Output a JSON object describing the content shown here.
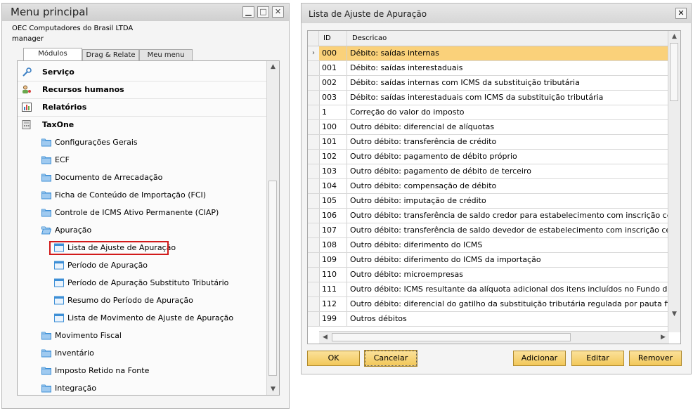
{
  "menu_window": {
    "title": "Menu principal",
    "company": "OEC Computadores do Brasil LTDA",
    "user": "manager",
    "tabs": [
      {
        "label": "Módulos",
        "active": true
      },
      {
        "label": "Drag & Relate",
        "active": false
      },
      {
        "label": "Meu menu",
        "active": false
      }
    ],
    "modules": [
      {
        "label": "Serviço",
        "icon": "wrench-icon"
      },
      {
        "label": "Recursos humanos",
        "icon": "people-icon"
      },
      {
        "label": "Relatórios",
        "icon": "report-chart-icon"
      },
      {
        "label": "TaxOne",
        "icon": "calculator-icon"
      }
    ],
    "taxone_folders_top": [
      "Configurações Gerais",
      "ECF",
      "Documento de Arrecadação",
      "Ficha de Conteúdo de Importação (FCI)",
      "Controle de ICMS Ativo Permanente (CIAP)"
    ],
    "open_folder": "Apuração",
    "apuracao_items": [
      "Lista de Ajuste de Apuração",
      "Período de Apuração",
      "Período de Apuração Substituto Tributário",
      "Resumo do Período de Apuração",
      "Lista de Movimento de Ajuste de Apuração"
    ],
    "taxone_folders_bottom": [
      "Movimento Fiscal",
      "Inventário",
      "Imposto Retido na Fonte",
      "Integração"
    ],
    "highlighted_item": "Lista de Ajuste de Apuração"
  },
  "list_window": {
    "title": "Lista de Ajuste de Apuração",
    "columns": [
      "ID",
      "Descricao"
    ],
    "rows": [
      {
        "id": "000",
        "desc": "Débito: saídas internas",
        "selected": true
      },
      {
        "id": "001",
        "desc": "Débito: saídas interestaduais"
      },
      {
        "id": "002",
        "desc": "Débito: saídas internas com ICMS da substituição tributária"
      },
      {
        "id": "003",
        "desc": "Débito: saídas interestaduais com ICMS da substituição tributária"
      },
      {
        "id": "1",
        "desc": "Correção do valor do imposto"
      },
      {
        "id": "100",
        "desc": "Outro débito: diferencial de alíquotas"
      },
      {
        "id": "101",
        "desc": "Outro débito: transferência de crédito"
      },
      {
        "id": "102",
        "desc": "Outro débito: pagamento de débito próprio"
      },
      {
        "id": "103",
        "desc": "Outro débito: pagamento de débito de terceiro"
      },
      {
        "id": "104",
        "desc": "Outro débito: compensação de débito"
      },
      {
        "id": "105",
        "desc": "Outro débito: imputação de crédito"
      },
      {
        "id": "106",
        "desc": "Outro débito: transferência de saldo credor para estabelecimento com inscrição centralizadora"
      },
      {
        "id": "107",
        "desc": "Outro débito: transferência de saldo devedor de estabelecimento com inscrição centralizada"
      },
      {
        "id": "108",
        "desc": "Outro débito: diferimento do ICMS"
      },
      {
        "id": "109",
        "desc": "Outro débito: diferimento do ICMS da importação"
      },
      {
        "id": "110",
        "desc": "Outro débito: microempresas"
      },
      {
        "id": "111",
        "desc": "Outro débito: ICMS resultante da alíquota adicional dos itens incluídos no Fundo de Combate à P"
      },
      {
        "id": "112",
        "desc": "Outro débito: diferencial do gatilho da substituição tributária regulada por pauta fiscal"
      },
      {
        "id": "199",
        "desc": "Outros débitos"
      }
    ],
    "buttons": {
      "ok": "OK",
      "cancel": "Cancelar",
      "add": "Adicionar",
      "edit": "Editar",
      "remove": "Remover"
    }
  },
  "colors": {
    "selected_row": "#fad17a",
    "button_fill": "#f2c85a",
    "highlight_border": "#d11a1a",
    "folder_icon": "#3d8fd6"
  }
}
